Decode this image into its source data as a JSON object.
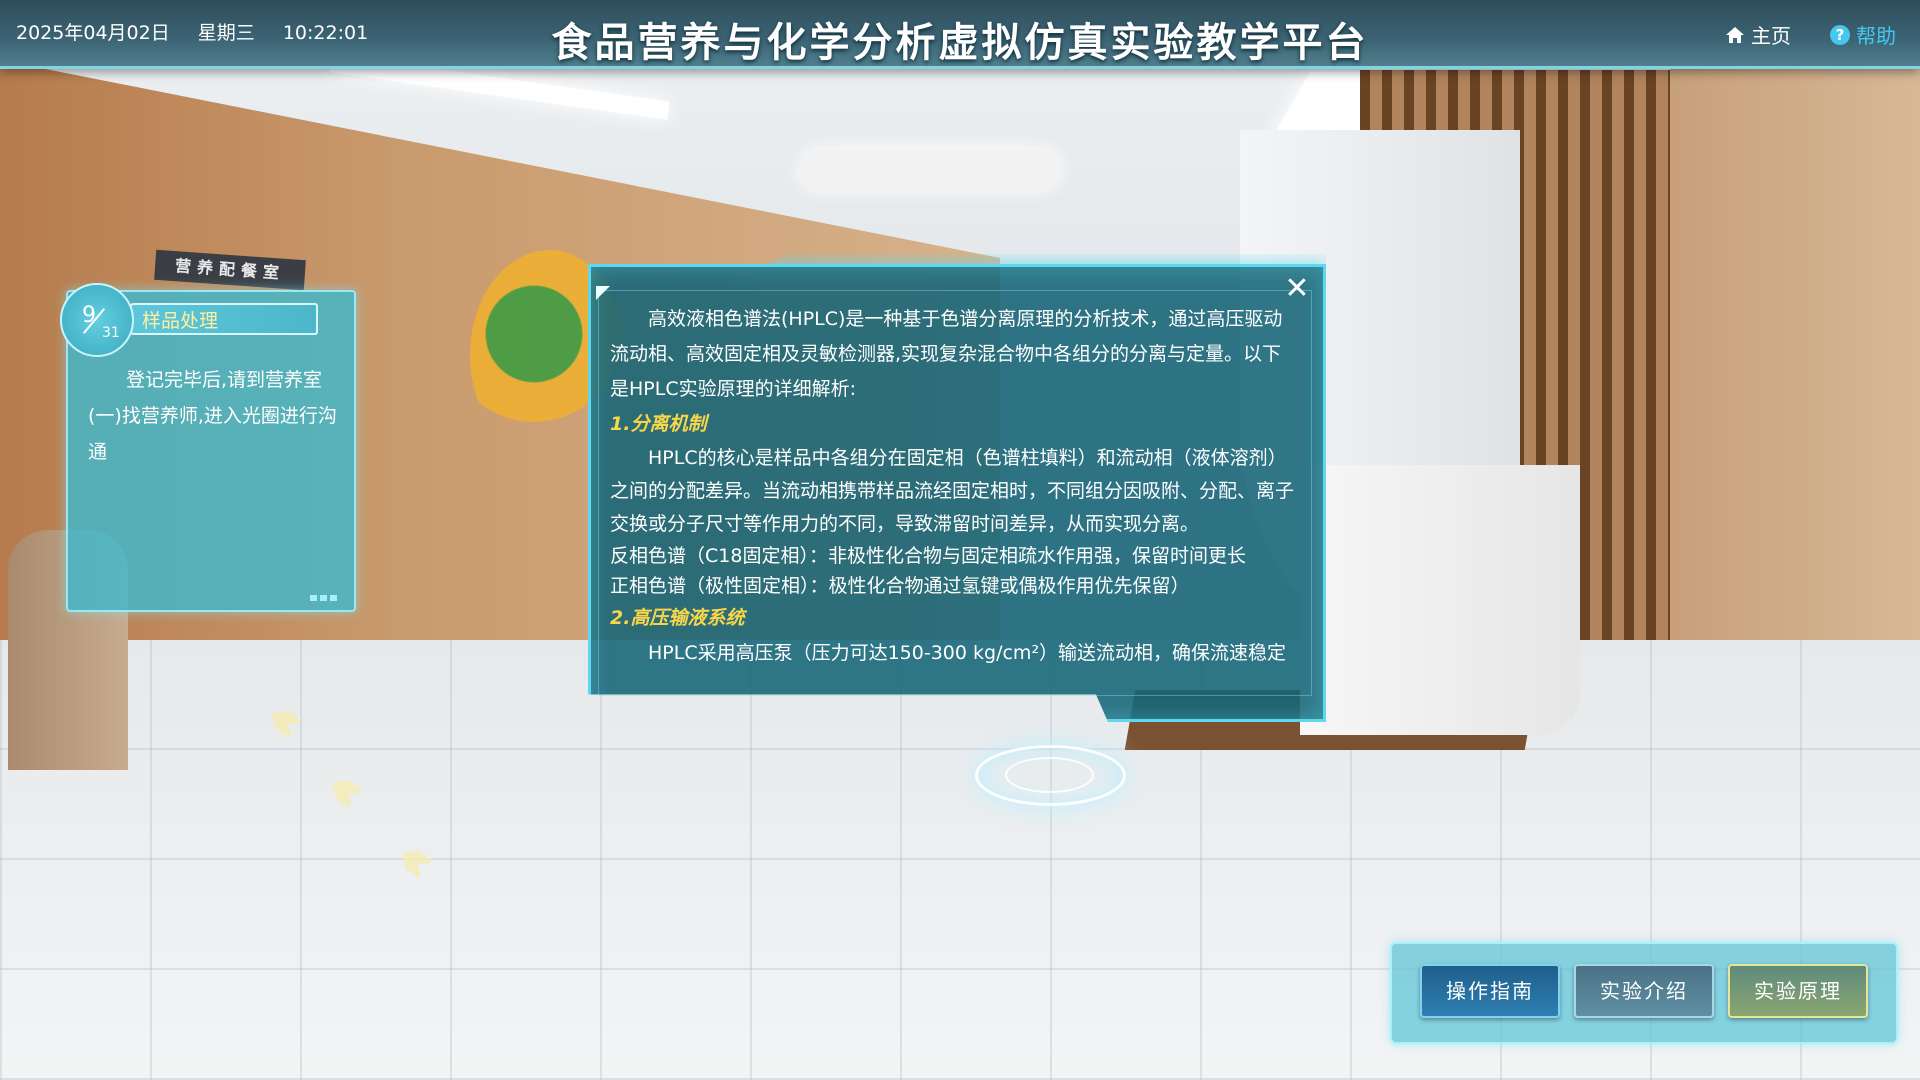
{
  "header": {
    "date": "2025年04月02日",
    "weekday": "星期三",
    "time": "10:22:01",
    "title": "食品营养与化学分析虚拟仿真实验教学平台",
    "home_label": "主页",
    "help_label": "帮助",
    "home_icon": "home-icon",
    "help_icon": "help-icon"
  },
  "scene": {
    "sign_text": "营养配餐室"
  },
  "task": {
    "step_current": "9",
    "step_total": "31",
    "step_title": "样品处理",
    "instruction": "登记完毕后,请到营养室(一)找营养师,进入光圈进行沟通"
  },
  "dialog": {
    "intro": "高效液相色谱法(HPLC)是一种基于色谱分离原理的分析技术，通过高压驱动流动相、高效固定相及灵敏检测器,实现复杂混合物中各组分的分离与定量。以下是HPLC实验原理的详细解析:",
    "section1_title": "1.分离机制",
    "section1_text": "HPLC的核心是样品中各组分在固定相（色谱柱填料）和流动相（液体溶剂）之间的分配差异。当流动相携带样品流经固定相时，不同组分因吸附、分配、离子交换或分子尺寸等作用力的不同，导致滞留时间差异，从而实现分离。",
    "section1_rp": "反相色谱（C18固定相）：非极性化合物与固定相疏水作用强，保留时间更长",
    "section1_np": "正相色谱（极性固定相）：极性化合物通过氢键或偶极作用优先保留）",
    "section2_title": "2.高压输液系统",
    "section2_text": "HPLC采用高压泵（压力可达150-300 kg/cm²）输送流动相，确保流速稳定",
    "close_icon": "close-icon"
  },
  "buttons": {
    "guide": "操作指南",
    "intro": "实验介绍",
    "principle": "实验原理"
  }
}
